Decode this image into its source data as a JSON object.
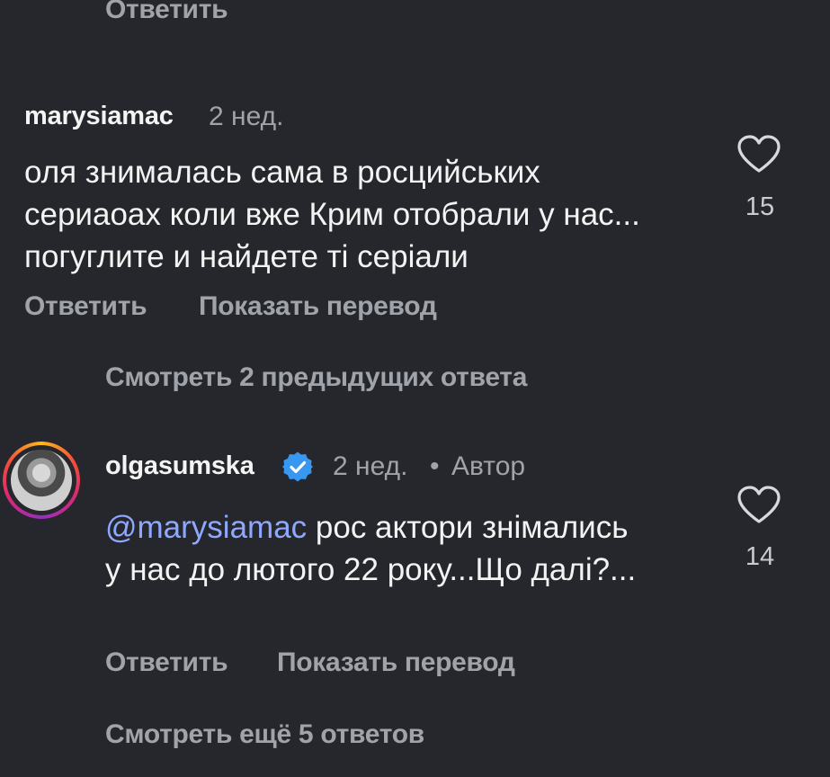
{
  "top": {
    "reply_label": "Ответить"
  },
  "comment1": {
    "username": "marysiamac",
    "time": "2 нед.",
    "text": "оля знималась сама в росцийських сериаоах  коли вже Крим отобрали у нас... погуглите и найдете ті серіали",
    "likes": "15",
    "reply_label": "Ответить",
    "translate_label": "Показать перевод",
    "icon": "heart-icon"
  },
  "view_previous": {
    "label": "Смотреть 2 предыдущих ответа"
  },
  "comment2": {
    "username": "olgasumska",
    "time": "2 нед.",
    "separator": "•",
    "author_label": "Автор",
    "mention": "@marysiamac",
    "text": " рос актори знімались у нас до лютого 22 року...Що далі?...",
    "likes": "14",
    "reply_label": "Ответить",
    "translate_label": "Показать перевод",
    "verified_icon": "verified-badge-icon",
    "icon": "heart-icon"
  },
  "view_more": {
    "label": "Смотреть ещё 5 ответов"
  },
  "colors": {
    "background": "#25272c",
    "mention": "#8fa8ff",
    "verified": "#3897f0",
    "muted": "#a0a3a9"
  }
}
